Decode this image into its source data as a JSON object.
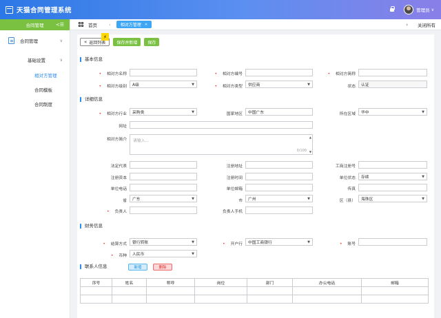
{
  "app": {
    "title": "天猫合同管理系统",
    "username": "管理员",
    "caret": "∨"
  },
  "sidebar": {
    "header": "合同管理",
    "collapse_icon": "<☰",
    "group": {
      "label": "合同管理"
    },
    "sub": {
      "label": "基础设置"
    },
    "leaves": [
      {
        "label": "相对方管理",
        "active": true
      },
      {
        "label": "合同模板",
        "active": false
      },
      {
        "label": "合同制度",
        "active": false
      }
    ]
  },
  "tabs": {
    "home": "首页",
    "active_tab": "相对方管理",
    "close_all": "关闭所有"
  },
  "toolbar": {
    "back": "返回列表",
    "save_new": "保存并新增",
    "save": "保存",
    "pin_label": "⚡"
  },
  "basic": {
    "title": "基本信息",
    "name_label": "相对方名称",
    "code_label": "相对方编号",
    "short_label": "相对方简称",
    "level_label": "相对方级别",
    "level_value": "A级",
    "type_label": "相对方类型",
    "type_value": "供应商",
    "status_label": "状态",
    "status_value": "认证"
  },
  "detail": {
    "title": "详细信息",
    "industry_label": "相对方行业",
    "industry_value": "采购类",
    "country_label": "国家地区",
    "country_value": "中国广东",
    "region_label": "所在区域",
    "region_value": "华中",
    "website_label": "网址",
    "intro_label": "相对方简介",
    "intro_placeholder": "请输入...",
    "intro_count": "0/100",
    "legal_label": "法定代表",
    "reg_addr_label": "注册地址",
    "biz_no_label": "工商注册号",
    "capital_label": "注册资本",
    "reg_time_label": "注册时间",
    "unit_status_label": "单位状态",
    "unit_status_value": "存续",
    "phone_label": "单位电话",
    "email_label": "单位邮箱",
    "fax_label": "传真",
    "province_label": "省",
    "province_value": "广东",
    "city_label": "市",
    "city_value": "广州",
    "district_label": "区（县）",
    "district_value": "海珠区",
    "owner_label": "负责人",
    "owner_phone_label": "负责人手机"
  },
  "finance": {
    "title": "财务信息",
    "settle_label": "结算方式",
    "settle_value": "银行转账",
    "bank_label": "开户行",
    "bank_value": "中国工商银行",
    "account_label": "账号",
    "currency_label": "币种",
    "currency_value": "人民币"
  },
  "contact": {
    "title": "联系人信息",
    "add": "新增",
    "delete": "删除",
    "columns": [
      "序号",
      "姓名",
      "称呼",
      "岗位",
      "部门",
      "办公电话",
      "邮箱"
    ]
  }
}
